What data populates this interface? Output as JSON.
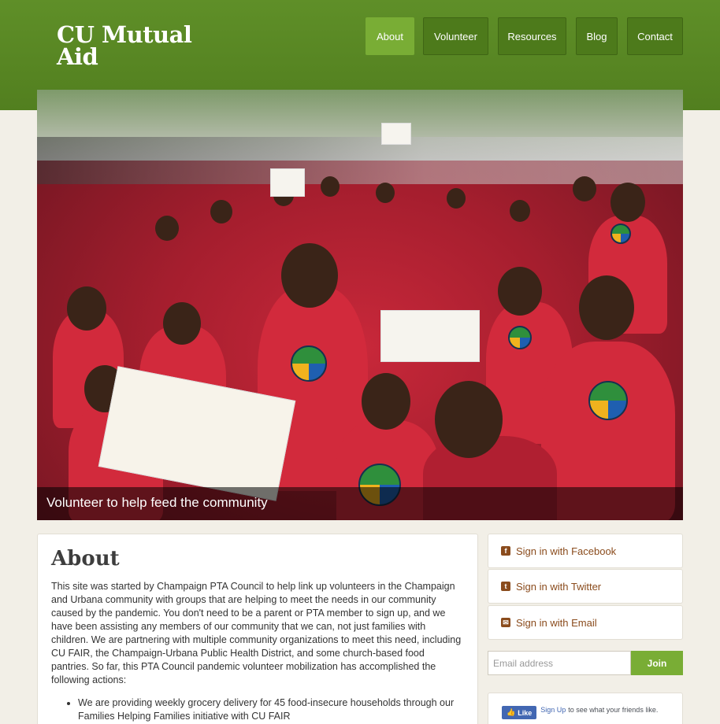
{
  "site": {
    "title": "CU Mutual Aid"
  },
  "nav": {
    "items": [
      {
        "label": "About",
        "active": true
      },
      {
        "label": "Volunteer",
        "active": false
      },
      {
        "label": "Resources",
        "active": false
      },
      {
        "label": "Blog",
        "active": false
      },
      {
        "label": "Contact",
        "active": false
      }
    ]
  },
  "hero": {
    "caption": "Volunteer to help feed the community"
  },
  "about": {
    "title": "About",
    "paragraph": "This site was started by Champaign PTA Council to help link up volunteers in the Champaign and Urbana community with groups that are helping to meet the needs in our community caused by the pandemic.  You don't need to be a parent or PTA member to sign up, and we have been assisting any members of our community that we can, not just families with children.  We are partnering with multiple community organizations to meet this need, including CU FAIR, the Champaign-Urbana Public Health District, and some church-based food pantries.  So far, this PTA Council pandemic volunteer mobilization has accomplished the following actions:",
    "bullets": [
      "We are providing weekly grocery delivery for 45 food-insecure households through our Families Helping Families initiative with CU FAIR"
    ]
  },
  "signin": {
    "facebook": {
      "label": "Sign in with Facebook",
      "icon": "facebook-icon",
      "glyph": "f"
    },
    "twitter": {
      "label": "Sign in with Twitter",
      "icon": "twitter-icon",
      "glyph": "t"
    },
    "email": {
      "label": "Sign in with Email",
      "icon": "envelope-icon",
      "glyph": "✉"
    }
  },
  "newsletter": {
    "placeholder": "Email address",
    "button": "Join"
  },
  "facebook_widget": {
    "like": "Like",
    "signup": "Sign Up",
    "text": "to see what your friends like."
  },
  "colors": {
    "brand_green": "#5f8f28",
    "accent_green": "#79ad35",
    "link_brown": "#8a4b1c"
  }
}
